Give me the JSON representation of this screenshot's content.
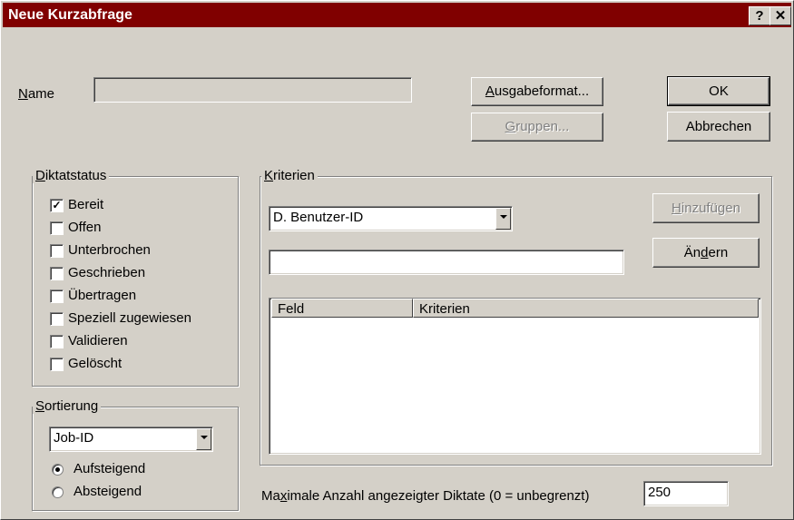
{
  "window": {
    "title": "Neue Kurzabfrage",
    "help_button": "?",
    "close_button": "✕"
  },
  "name": {
    "label_accel": "N",
    "label_rest": "ame",
    "value": ""
  },
  "buttons": {
    "ausgabeformat_accel": "A",
    "ausgabeformat_rest": "usgabeformat...",
    "gruppen_accel": "G",
    "gruppen_rest": "ruppen...",
    "ok": "OK",
    "abbrechen": "Abbrechen",
    "hinzufuegen_accel": "H",
    "hinzufuegen_rest": "inzufügen",
    "aendern_pre": "Än",
    "aendern_accel": "d",
    "aendern_rest": "ern"
  },
  "diktatstatus": {
    "legend_accel": "D",
    "legend_rest": "iktatstatus",
    "items": [
      {
        "label": "Bereit",
        "checked": true
      },
      {
        "label": "Offen",
        "checked": false
      },
      {
        "label": "Unterbrochen",
        "checked": false
      },
      {
        "label": "Geschrieben",
        "checked": false
      },
      {
        "label": "Übertragen",
        "checked": false
      },
      {
        "label": "Speziell zugewiesen",
        "checked": false
      },
      {
        "label": "Validieren",
        "checked": false
      },
      {
        "label": "Gelöscht",
        "checked": false
      }
    ]
  },
  "sortierung": {
    "legend_accel": "S",
    "legend_rest": "ortierung",
    "selected": "Job-ID",
    "options": [
      {
        "label": "Aufsteigend",
        "selected": true
      },
      {
        "label": "Absteigend",
        "selected": false
      }
    ]
  },
  "kriterien": {
    "legend_accel": "K",
    "legend_rest": "riterien",
    "field_selected": "D. Benutzer-ID",
    "value": "",
    "columns": [
      "Feld",
      "Kriterien"
    ],
    "rows": []
  },
  "max": {
    "label_pre": "Ma",
    "label_accel": "x",
    "label_rest": "imale Anzahl angezeigter Diktate (0 = unbegrenzt)",
    "value": "250"
  },
  "colors": {
    "titlebar": "#800000",
    "face": "#d4d0c8"
  }
}
